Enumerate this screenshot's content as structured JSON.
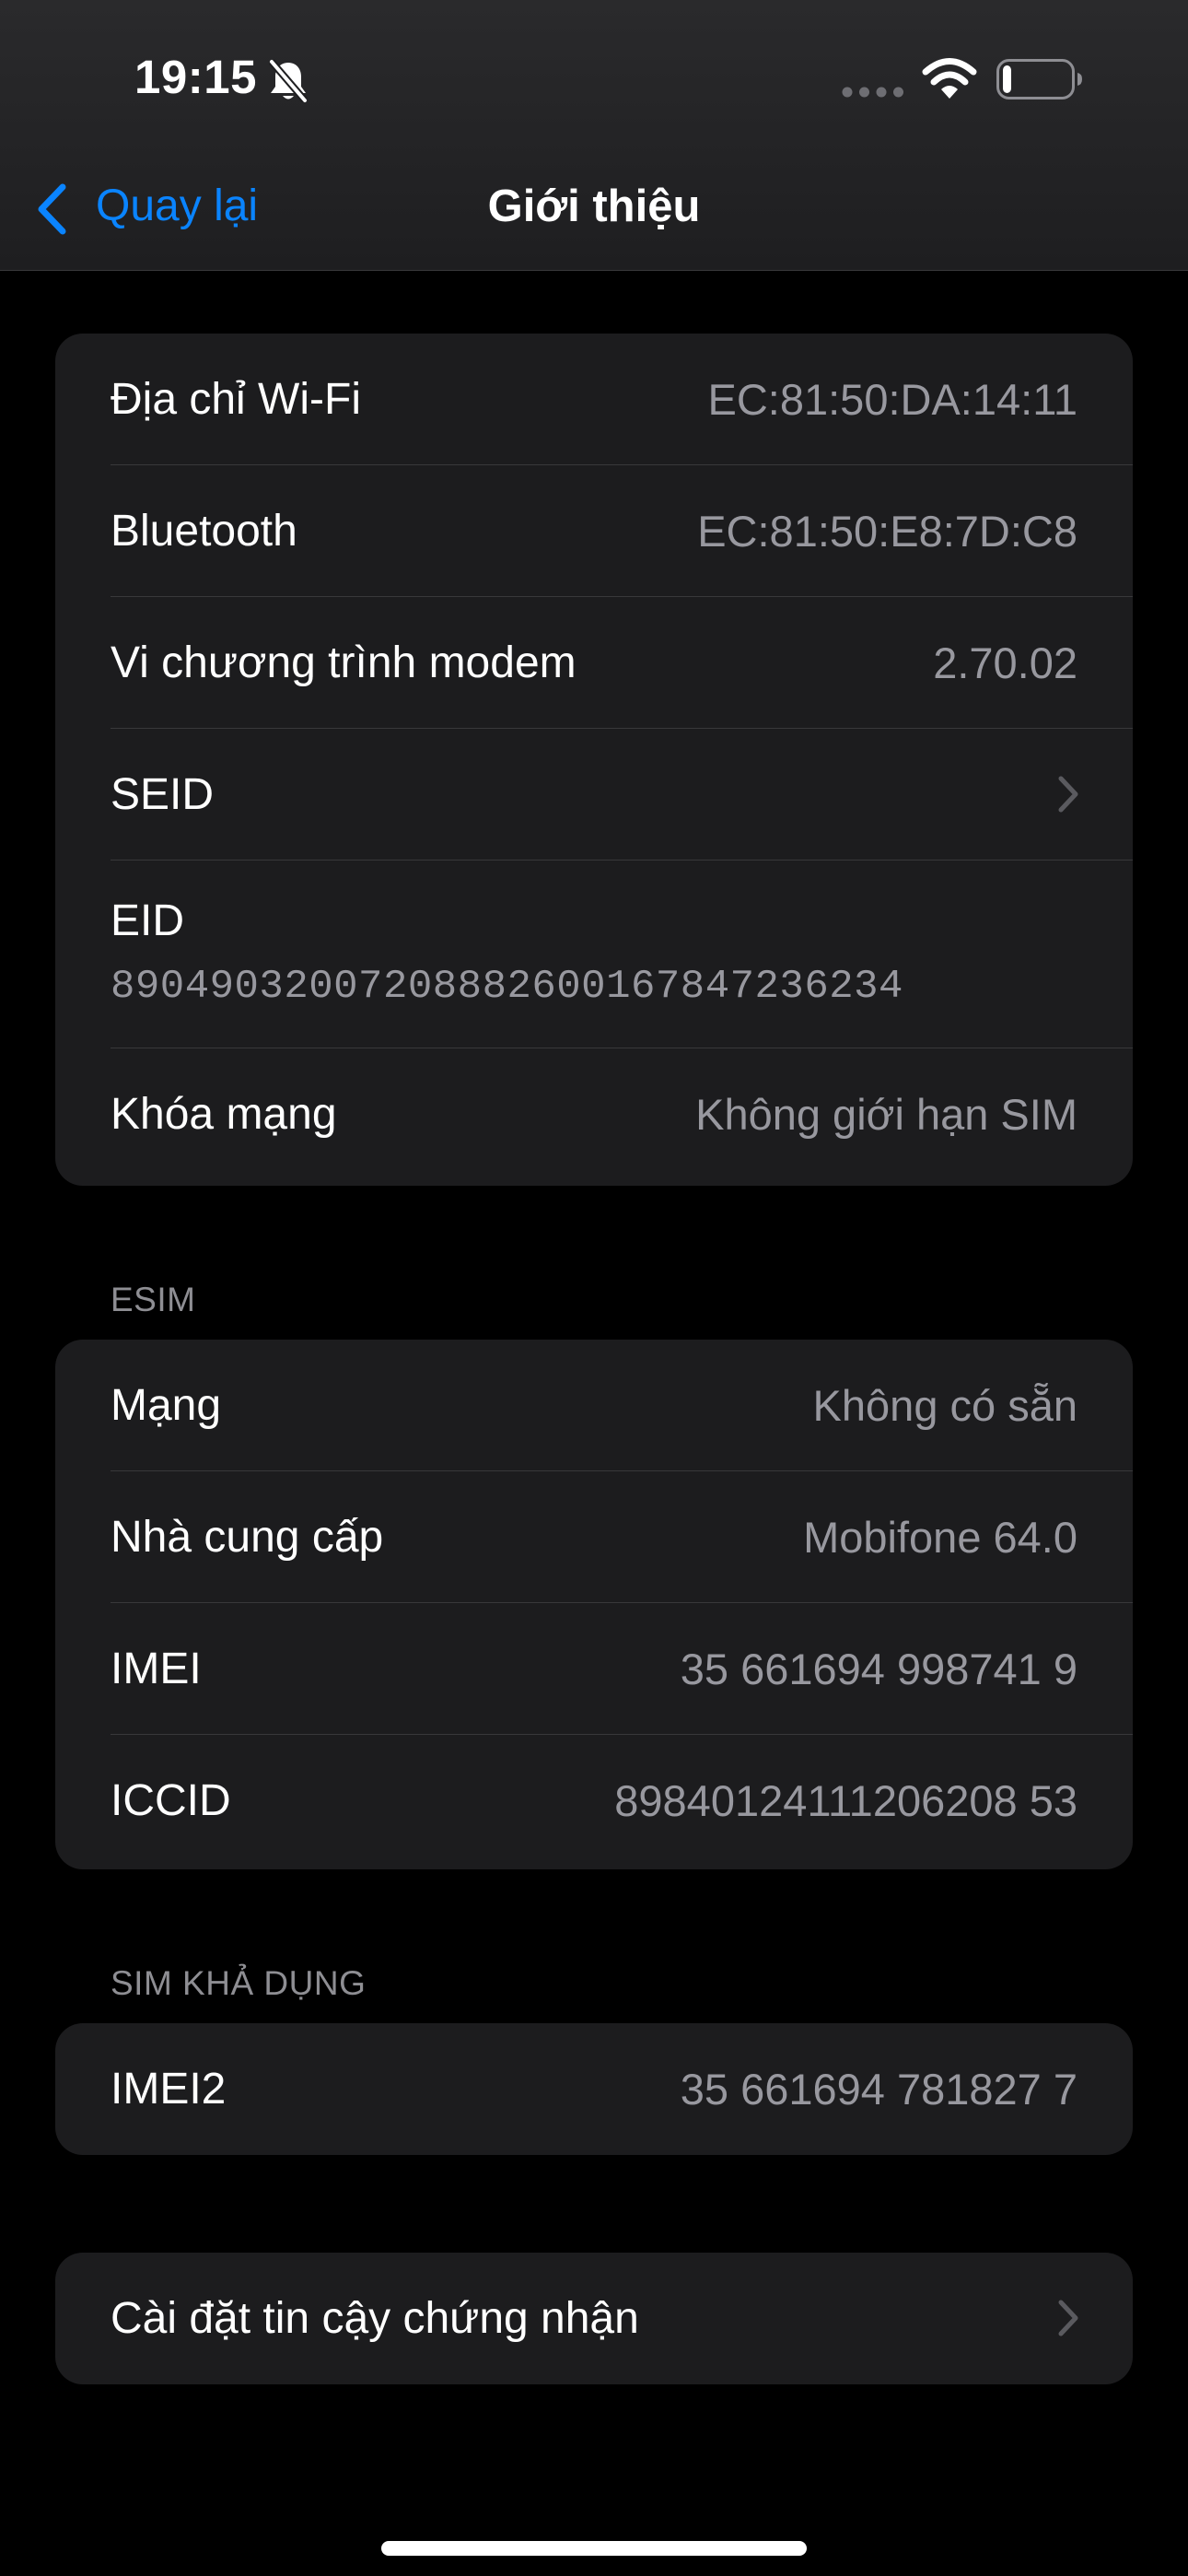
{
  "status_bar": {
    "time": "19:15",
    "icons": [
      "bell-slash-icon",
      "cellular-dots-icon",
      "wifi-icon",
      "battery-icon"
    ],
    "battery_level": 0.12
  },
  "nav": {
    "back_label": "Quay lại",
    "title": "Giới thiệu"
  },
  "groups": {
    "device": {
      "rows": [
        {
          "label": "Địa chỉ Wi-Fi",
          "value": "EC:81:50:DA:14:11"
        },
        {
          "label": "Bluetooth",
          "value": "EC:81:50:E8:7D:C8"
        },
        {
          "label": "Vi chương trình modem",
          "value": "2.70.02"
        },
        {
          "label": "SEID"
        },
        {
          "label": "EID",
          "value": "89049032007208882600167847236234"
        },
        {
          "label": "Khóa mạng",
          "value": "Không giới hạn SIM"
        }
      ]
    },
    "esim": {
      "header": "ESIM",
      "rows": [
        {
          "label": "Mạng",
          "value": "Không có sẵn"
        },
        {
          "label": "Nhà cung cấp",
          "value": "Mobifone 64.0"
        },
        {
          "label": "IMEI",
          "value": "35 661694 998741 9"
        },
        {
          "label": "ICCID",
          "value": "89840124111206208 53"
        }
      ]
    },
    "sim": {
      "header": "SIM KHẢ DỤNG",
      "rows": [
        {
          "label": "IMEI2",
          "value": "35 661694 781827 7"
        }
      ]
    },
    "trust": {
      "rows": [
        {
          "label": "Cài đặt tin cậy chứng nhận"
        }
      ]
    }
  },
  "colors": {
    "accent": "#0a84ff",
    "background": "#000000",
    "cell": "#1c1c1e",
    "secondary_text": "#98989f"
  }
}
